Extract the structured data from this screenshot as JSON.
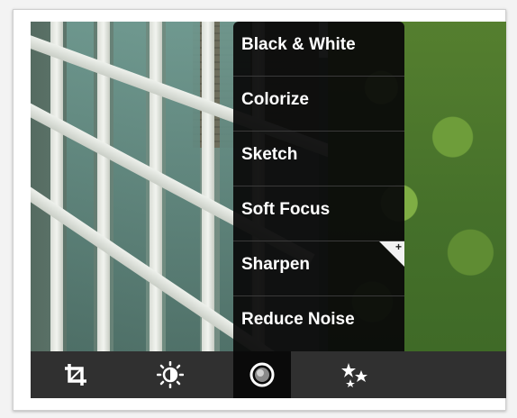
{
  "filters_menu": {
    "items": [
      {
        "label": "Black & White"
      },
      {
        "label": "Colorize"
      },
      {
        "label": "Sketch"
      },
      {
        "label": "Soft Focus"
      },
      {
        "label": "Sharpen"
      },
      {
        "label": "Reduce Noise"
      }
    ],
    "badge_icon": "plus-corner-icon"
  },
  "toolbar": {
    "tools": [
      {
        "name": "crop",
        "icon": "crop-icon",
        "glyph": "⌗"
      },
      {
        "name": "brightness",
        "icon": "sun-icon",
        "glyph": "☀"
      },
      {
        "name": "filters",
        "icon": "filter-circle-icon",
        "glyph": "◉",
        "active": true
      },
      {
        "name": "effects",
        "icon": "sparkle-stars-icon",
        "glyph": "✦"
      }
    ]
  },
  "colors": {
    "menu_bg": "#0a0a0a",
    "toolbar_bg": "#303030",
    "text": "#ffffff"
  }
}
